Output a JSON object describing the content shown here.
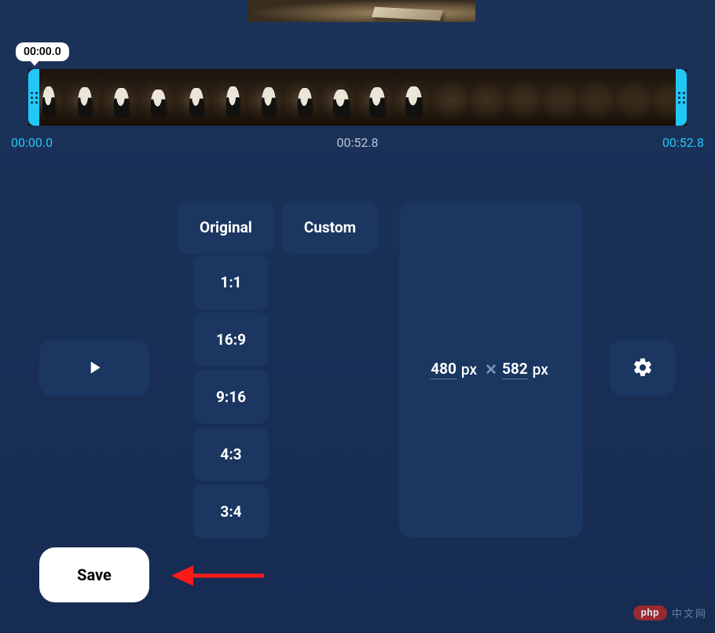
{
  "preview": {
    "visible": true
  },
  "timeline": {
    "current_badge": "00:00.0",
    "start_label": "00:00.0",
    "mid_label": "00:52.8",
    "end_label": "00:52.8",
    "frame_count": 18
  },
  "tabs": {
    "original": "Original",
    "custom": "Custom"
  },
  "ratios": {
    "items": [
      "1:1",
      "16:9",
      "9:16",
      "4:3",
      "3:4"
    ]
  },
  "dimensions": {
    "width": "480",
    "height": "582",
    "unit": "px"
  },
  "actions": {
    "save_label": "Save"
  },
  "watermark": {
    "brand": "php",
    "cn": "中文网"
  }
}
